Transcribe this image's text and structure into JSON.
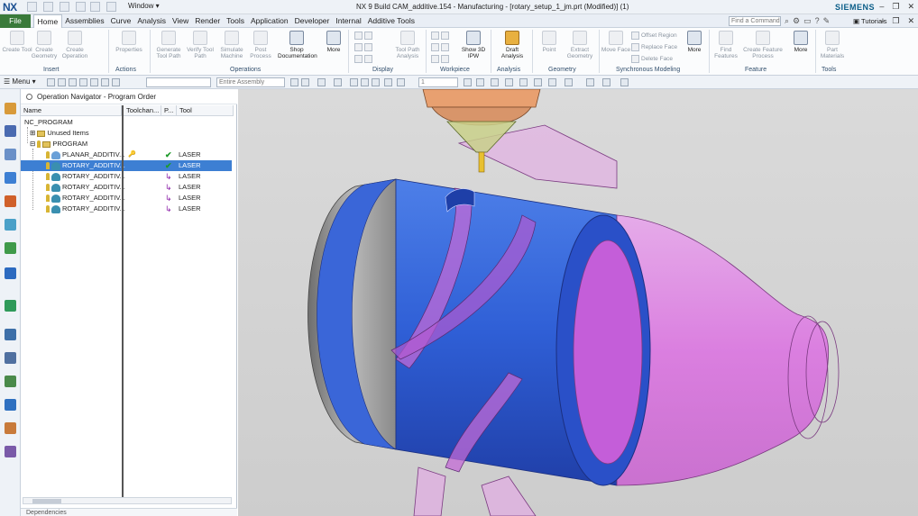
{
  "title_bar": {
    "logo": "NX",
    "window_menu": "Window",
    "title": "NX 9  Build CAM_additive.154 - Manufacturing - [rotary_setup_1_jm.prt (Modified)]  (1)",
    "brand": "SIEMENS"
  },
  "menu": {
    "file": "File",
    "tabs": [
      "Home",
      "Assemblies",
      "Curve",
      "Analysis",
      "View",
      "Render",
      "Tools",
      "Application",
      "Developer",
      "Internal",
      "Additive Tools"
    ],
    "active_tab": "Home",
    "find_command_placeholder": "Find a Command",
    "tutorials": "Tutorials"
  },
  "ribbon": {
    "groups": [
      {
        "label": "Insert",
        "buttons": [
          "Create Tool",
          "Create Geometry",
          "Create Operation"
        ]
      },
      {
        "label": "Actions",
        "buttons": [
          "Properties"
        ]
      },
      {
        "label": "Operations",
        "buttons": [
          "Generate Tool Path",
          "Verify Tool Path",
          "Simulate Machine",
          "Post Process",
          "Shop Documentation",
          "More"
        ]
      },
      {
        "label": "Display",
        "buttons": [
          "Tool Path Analysis"
        ]
      },
      {
        "label": "Workpiece",
        "buttons": [
          "Show 3D IPW"
        ]
      },
      {
        "label": "Analysis",
        "buttons": [
          "Draft Analysis"
        ]
      },
      {
        "label": "Geometry",
        "buttons": [
          "Point",
          "Extract Geometry"
        ]
      },
      {
        "label": "Synchronous Modeling",
        "buttons": [
          "Move Face",
          "Offset Region",
          "Replace Face",
          "Delete Face",
          "More"
        ]
      },
      {
        "label": "Feature",
        "buttons": [
          "Find Features",
          "Create Feature Process",
          "More"
        ]
      },
      {
        "label": "Tools",
        "buttons": [
          "Part Materials"
        ]
      }
    ]
  },
  "toolbar": {
    "menu": "Menu",
    "assembly_filter": "Entire Assembly",
    "layer_value": "1"
  },
  "navigator": {
    "title": "Operation Navigator - Program Order",
    "columns": [
      "Name",
      "Toolchan...",
      "P...",
      "Tool"
    ],
    "tree": [
      {
        "name": "NC_PROGRAM",
        "level": 0
      },
      {
        "name": "Unused Items",
        "level": 1
      },
      {
        "name": "PROGRAM",
        "level": 1
      }
    ],
    "operations": [
      {
        "name": "PLANAR_ADDITIV...",
        "toolchange": true,
        "status": "complete",
        "tool": "LASER",
        "selected": false
      },
      {
        "name": "ROTARY_ADDITIV...",
        "toolchange": false,
        "status": "complete",
        "tool": "LASER",
        "selected": true
      },
      {
        "name": "ROTARY_ADDITIV...",
        "toolchange": false,
        "status": "regenerate",
        "tool": "LASER",
        "selected": false
      },
      {
        "name": "ROTARY_ADDITIV...",
        "toolchange": false,
        "status": "regenerate",
        "tool": "LASER",
        "selected": false
      },
      {
        "name": "ROTARY_ADDITIV...",
        "toolchange": false,
        "status": "regenerate",
        "tool": "LASER",
        "selected": false
      },
      {
        "name": "ROTARY_ADDITIV...",
        "toolchange": false,
        "status": "regenerate",
        "tool": "LASER",
        "selected": false
      }
    ],
    "dependencies_label": "Dependencies"
  },
  "colors": {
    "file_tab": "#3a7a3a",
    "selection": "#3d7fd3",
    "part_blue": "#2f5fd6",
    "part_magenta": "#d86ee0",
    "part_gray": "#9a9a9a",
    "nozzle": "#c9d08a",
    "laser_head": "#e8a070"
  }
}
